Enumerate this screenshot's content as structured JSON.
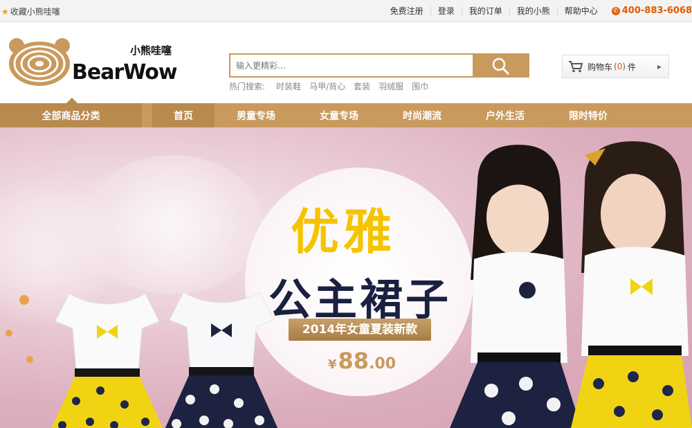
{
  "topbar": {
    "favorite": "收藏小熊哇噻",
    "links": [
      "免费注册",
      "登录",
      "我的订单",
      "我的小熊",
      "帮助中心"
    ],
    "hotline": "400-883-6068"
  },
  "logo": {
    "brand_cn": "小熊哇噻",
    "brand_en": "BearWow"
  },
  "search": {
    "placeholder": "输入更精彩...",
    "hot_label": "热门搜索:",
    "hot_keywords": [
      "时装鞋",
      "马甲/背心",
      "套装",
      "羽绒服",
      "围巾"
    ]
  },
  "cart": {
    "label": "购物车",
    "count_open": "(",
    "count": "0",
    "count_close": ")",
    "unit": "件"
  },
  "nav": {
    "all_categories": "全部商品分类",
    "items": [
      "首页",
      "男童专场",
      "女童专场",
      "时尚潮流",
      "户外生活",
      "限时特价"
    ]
  },
  "banner": {
    "title_main": "优雅",
    "title_sub": "公主裙子",
    "ribbon": "2014年女童夏装新款",
    "price_symbol": "¥",
    "price_integer": "88",
    "price_decimal": ".00"
  },
  "colors": {
    "brand": "#c99a5d",
    "brand_dark": "#b98a4e",
    "accent_orange": "#e05a00",
    "title_yellow": "#f5c400",
    "title_navy": "#1a2140"
  }
}
